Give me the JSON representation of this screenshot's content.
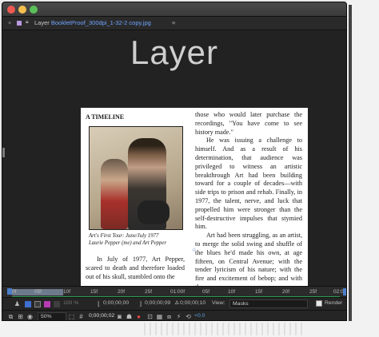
{
  "window": {
    "tab_close": "×",
    "tab_prefix": "Layer",
    "tab_filename": "BookletProof_300dpi_1-32-2 copy.jpg",
    "tab_menu": "≡"
  },
  "viewer": {
    "big_title": "Layer",
    "page": {
      "heading": "A TIMELINE",
      "caption_line1": "Art's First Tour: June/July 1977",
      "caption_line2": "Laurie Pepper (me) and Art Pepper",
      "left_para": "In July of 1977, Art Pepper, scared to death and therefore loaded out of his skull, stumbled onto the",
      "right_p1": "those who would later purchase the recordings, \"You have come to see history made.\"",
      "right_p2": "He was issuing a challenge to himself. And as a result of his determination, that audience was privileged to witness an artistic breakthrough Art had been building toward for a couple of decades—with side trips to prison and rehab. Finally, in 1977, the talent, nerve, and luck that propelled him were stronger than the self-destructive impulses that stymied him.",
      "right_p3": "Art had been struggling, as an artist, to merge the solid swing and shuffle of the blues he'd made his own, at age fifteen, on Central Avenue; with the tender lyricism of his nature; with the fire and excitement of bebop; and with the"
    }
  },
  "ruler": {
    "ticks": [
      "0f",
      "05f",
      "10f",
      "15f",
      "20f",
      "25f",
      "01:00f",
      "05f",
      "10f",
      "15f",
      "20f",
      "25f",
      "02:0"
    ]
  },
  "controls": {
    "opacity": "100 %",
    "time_start": "0;00;00;00",
    "time_end": "0;00;00;09",
    "duration": "Δ 0;00;00;10",
    "view_label": "View:",
    "view_value": "Masks",
    "render_label": "Render",
    "zoom": "50%",
    "current_time": "0;00;00;02",
    "exposure": "+0.0"
  },
  "colors": {
    "accent_blue": "#4a7ec9",
    "label_purple": "#b99ae0",
    "timeline_green": "#2f9d4f"
  }
}
